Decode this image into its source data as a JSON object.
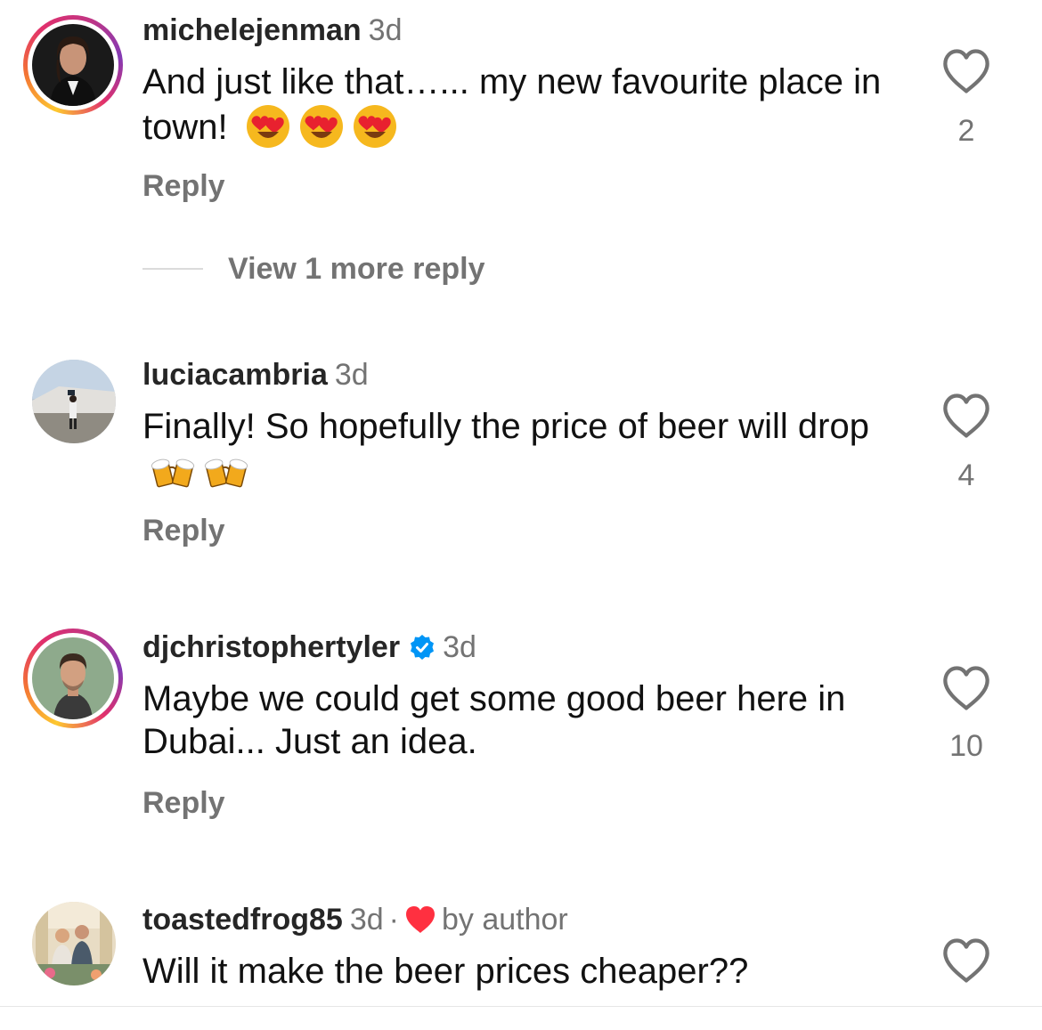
{
  "comments": [
    {
      "username": "michelejenman",
      "time": "3d",
      "text": "And just like that…... my new favourite place in town!",
      "emoji_names": [
        "heart-eyes-emoji",
        "heart-eyes-emoji",
        "heart-eyes-emoji"
      ],
      "reply_label": "Reply",
      "like_count": "2",
      "has_story_ring": true
    },
    {
      "username": "luciacambria",
      "time": "3d",
      "text": "Finally! So hopefully the price of beer will drop",
      "emoji_names": [
        "beer-mugs-emoji",
        "beer-mugs-emoji"
      ],
      "reply_label": "Reply",
      "like_count": "4",
      "has_story_ring": false
    },
    {
      "username": "djchristophertyler",
      "time": "3d",
      "verified": true,
      "text": "Maybe we could get some good beer here in Dubai... Just an idea.",
      "reply_label": "Reply",
      "like_count": "10",
      "has_story_ring": true
    },
    {
      "username": "toastedfrog85",
      "time": "3d",
      "separator": "·",
      "liked_by_author_label": "by author",
      "text": "Will it make the beer prices cheaper??",
      "has_story_ring": false
    }
  ],
  "view_more_replies": "View 1 more reply",
  "colors": {
    "muted_text": "#737373",
    "verified_blue": "#0095f6",
    "author_heart_red": "#ff3040"
  }
}
